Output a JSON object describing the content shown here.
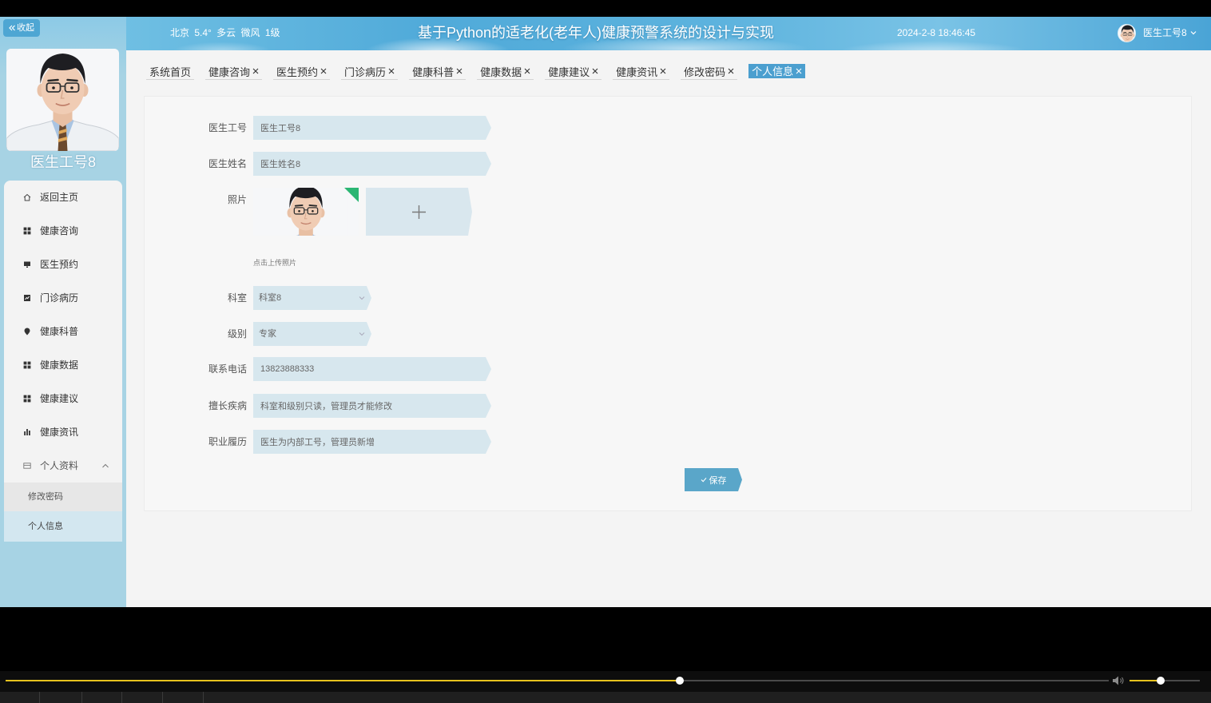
{
  "sidebar": {
    "collapse_label": "收起",
    "user_name": "医生工号8",
    "avatar_icon": "doctor-portrait",
    "menu": [
      {
        "label": "返回主页",
        "icon": "home-icon"
      },
      {
        "label": "健康咨询",
        "icon": "grid-icon"
      },
      {
        "label": "医生预约",
        "icon": "monitor-icon"
      },
      {
        "label": "门诊病历",
        "icon": "chart-box-icon"
      },
      {
        "label": "健康科普",
        "icon": "pin-icon"
      },
      {
        "label": "健康数据",
        "icon": "grid-icon"
      },
      {
        "label": "健康建议",
        "icon": "grid-icon"
      },
      {
        "label": "健康资讯",
        "icon": "bar-chart-icon"
      },
      {
        "label": "个人资料",
        "icon": "id-card-icon",
        "expanded": true
      }
    ],
    "submenu": [
      {
        "label": "修改密码",
        "active": false
      },
      {
        "label": "个人信息",
        "active": true
      }
    ]
  },
  "header": {
    "weather": "北京 5.4° 多云 微风 1级",
    "title": "基于Python的适老化(老年人)健康预警系统的设计与实现",
    "datetime": "2024-2-8 18:46:45",
    "user_label": "医生工号8"
  },
  "tabs": [
    {
      "label": "系统首页",
      "closable": false
    },
    {
      "label": "健康咨询",
      "closable": true
    },
    {
      "label": "医生预约",
      "closable": true
    },
    {
      "label": "门诊病历",
      "closable": true
    },
    {
      "label": "健康科普",
      "closable": true
    },
    {
      "label": "健康数据",
      "closable": true
    },
    {
      "label": "健康建议",
      "closable": true
    },
    {
      "label": "健康资讯",
      "closable": true
    },
    {
      "label": "修改密码",
      "closable": true
    },
    {
      "label": "个人信息",
      "closable": true,
      "active": true
    }
  ],
  "form": {
    "doctor_id": {
      "label": "医生工号",
      "value": "医生工号8"
    },
    "doctor_name": {
      "label": "医生姓名",
      "value": "医生姓名8"
    },
    "photo": {
      "label": "照片",
      "hint": "点击上传照片"
    },
    "department": {
      "label": "科室",
      "value": "科室8"
    },
    "level": {
      "label": "级别",
      "value": "专家"
    },
    "phone": {
      "label": "联系电话",
      "value": "13823888333"
    },
    "specialty": {
      "label": "擅长疾病",
      "value": "科室和级别只读，管理员才能修改"
    },
    "experience": {
      "label": "职业履历",
      "value": "医生为内部工号，管理员新增"
    },
    "save_label": "保存"
  },
  "player": {
    "progress": 0.611,
    "volume": 0.443
  },
  "colors": {
    "sidebar_bg": "#a7d3e4",
    "accent": "#4b9fcf",
    "input_bg": "#d7e7ee",
    "save_bg": "#5aa6c9",
    "progress": "#e6c21e",
    "photo_badge": "#2bb673"
  }
}
